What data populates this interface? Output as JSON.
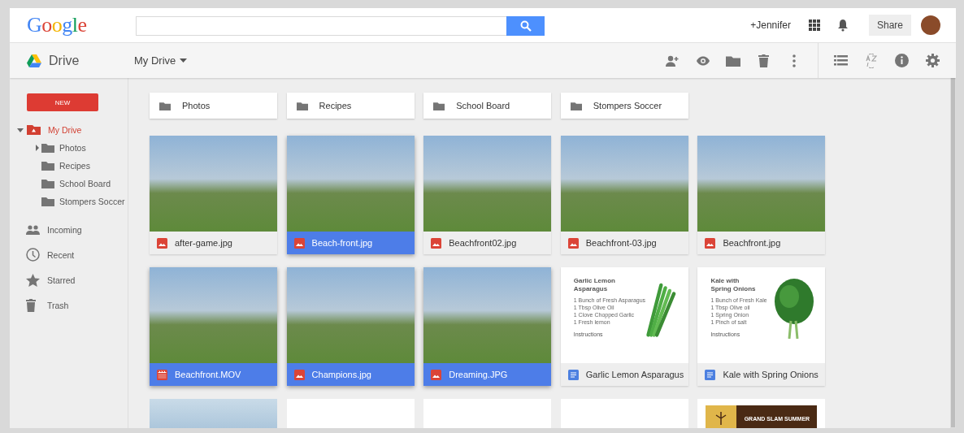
{
  "top_bar": {
    "logo": "Google",
    "user": "+Jennifer",
    "share_button": "Share"
  },
  "toolbar": {
    "app_name": "Drive",
    "location": "My Drive"
  },
  "sidebar": {
    "new_button": "NEW",
    "tree": [
      {
        "label": "My Drive",
        "selected": true,
        "expanded": true,
        "children": [
          {
            "label": "Photos",
            "selected": false,
            "expandable": true
          },
          {
            "label": "Recipes",
            "selected": false,
            "expandable": false
          },
          {
            "label": "School Board",
            "selected": false,
            "expandable": false
          },
          {
            "label": "Stompers Soccer",
            "selected": false,
            "expandable": false
          }
        ]
      }
    ],
    "nav": [
      {
        "label": "Incoming",
        "kind": "people",
        "selected": false
      },
      {
        "label": "Recent",
        "kind": "clock",
        "selected": false
      },
      {
        "label": "Starred",
        "kind": "star",
        "selected": false
      },
      {
        "label": "Trash",
        "kind": "trash",
        "selected": false
      }
    ]
  },
  "folders": [
    {
      "name": "Photos"
    },
    {
      "name": "Recipes"
    },
    {
      "name": "School Board"
    },
    {
      "name": "Stompers Soccer"
    }
  ],
  "files": [
    {
      "name": "after-game.jpg",
      "kind": "image",
      "selected": false
    },
    {
      "name": "Beach-front.jpg",
      "kind": "image",
      "selected": true
    },
    {
      "name": "Beachfront02.jpg",
      "kind": "image",
      "selected": false
    },
    {
      "name": "Beachfront-03.jpg",
      "kind": "image",
      "selected": false
    },
    {
      "name": "Beachfront.jpg",
      "kind": "image",
      "selected": false
    },
    {
      "name": "Beachfront.MOV",
      "kind": "video",
      "selected": true
    },
    {
      "name": "Champions.jpg",
      "kind": "image",
      "selected": true
    },
    {
      "name": "Dreaming.JPG",
      "kind": "image",
      "selected": true
    },
    {
      "name": "Garlic Lemon Asparagus",
      "kind": "doc",
      "selected": false,
      "preview": {
        "title": "Garlic Lemon Asparagus",
        "kind": "stalks",
        "lines": [
          "1 Bunch of Fresh Asparagus",
          "1 Tbsp Olive Oil",
          "1 Clove Chopped Garlic",
          "1 Fresh lemon"
        ],
        "footer": "Instructions"
      }
    },
    {
      "name": "Kale with Spring Onions",
      "kind": "doc",
      "selected": false,
      "preview": {
        "title": "Kale with Spring Onions",
        "kind": "leafy",
        "lines": [
          "1 Bunch of Fresh Kale",
          "1 Tbsp Olive oil",
          "1 Spring Onion",
          "1 Pinch of salt"
        ],
        "footer": "Instructions"
      }
    }
  ],
  "more_tiles": [
    {
      "kind": "photo"
    },
    {
      "kind": "blank"
    },
    {
      "kind": "blank"
    },
    {
      "kind": "blank"
    },
    {
      "kind": "banner",
      "text": "GRAND SLAM SUMMER"
    }
  ]
}
